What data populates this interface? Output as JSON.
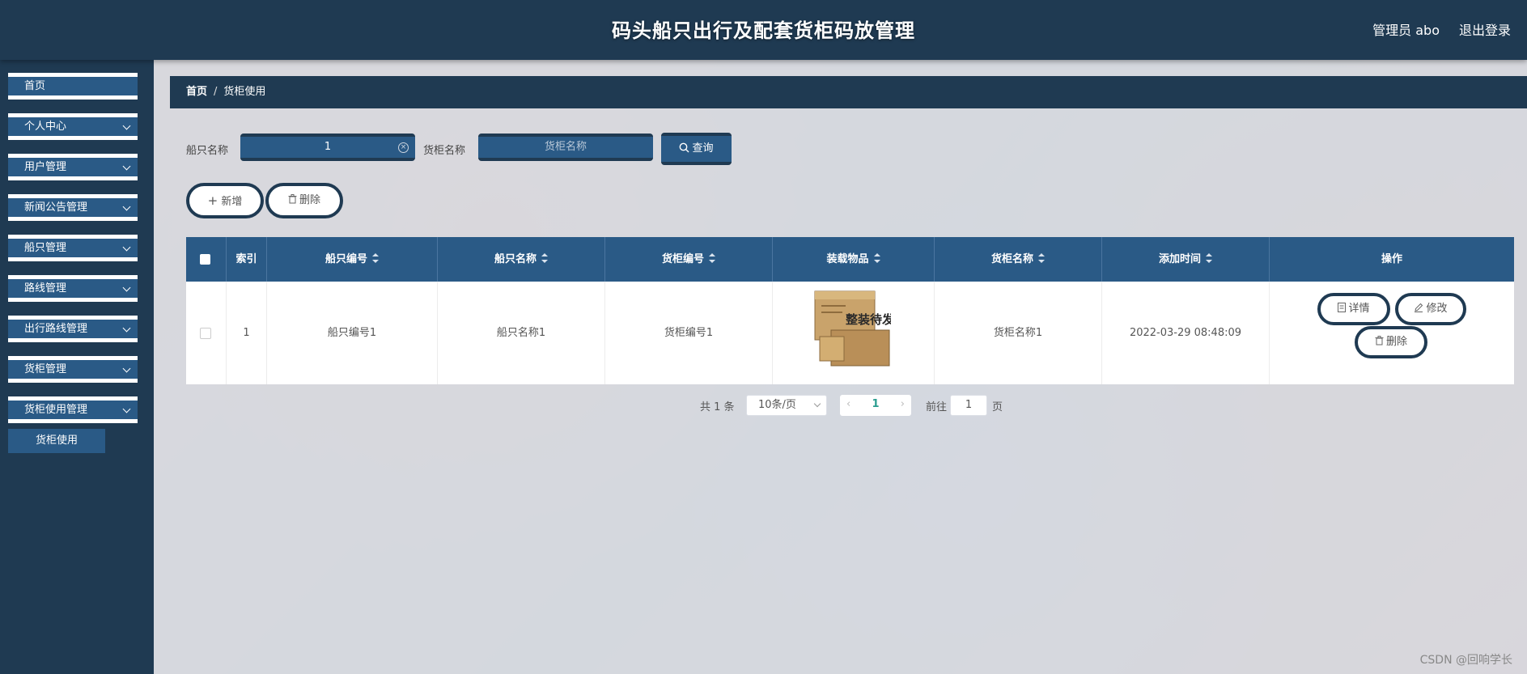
{
  "header": {
    "title": "码头船只出行及配套货柜码放管理",
    "user": "管理员 abo",
    "logout": "退出登录"
  },
  "sidebar": {
    "items": [
      {
        "label": "首页"
      },
      {
        "label": "个人中心"
      },
      {
        "label": "用户管理"
      },
      {
        "label": "新闻公告管理"
      },
      {
        "label": "船只管理"
      },
      {
        "label": "路线管理"
      },
      {
        "label": "出行路线管理"
      },
      {
        "label": "货柜管理"
      },
      {
        "label": "货柜使用管理"
      }
    ],
    "submenu": {
      "label": "货柜使用"
    }
  },
  "breadcrumb": {
    "home": "首页",
    "separator": "/",
    "current": "货柜使用"
  },
  "search": {
    "ship_label": "船只名称",
    "ship_value": "1",
    "container_label": "货柜名称",
    "container_placeholder": "货柜名称",
    "query_label": "查询"
  },
  "actions": {
    "add_label": "新增",
    "delete_label": "删除"
  },
  "table": {
    "headers": [
      "索引",
      "船只编号",
      "船只名称",
      "货柜编号",
      "装载物品",
      "货柜名称",
      "添加时间",
      "操作"
    ],
    "rows": [
      {
        "index": "1",
        "ship_no": "船只编号1",
        "ship_name": "船只名称1",
        "container_no": "货柜编号1",
        "goods_image_text": "整装待发",
        "container_name": "货柜名称1",
        "added_time": "2022-03-29 08:48:09",
        "ops": {
          "detail": "详情",
          "edit": "修改",
          "delete": "删除"
        }
      }
    ]
  },
  "pagination": {
    "total": "共 1 条",
    "page_size": "10条/页",
    "current_page": "1",
    "goto_label": "前往",
    "goto_value": "1",
    "page_suffix": "页"
  },
  "watermark": "CSDN @回响学长",
  "colors": {
    "primary": "#1f3a52",
    "accent": "#2a5a86"
  }
}
